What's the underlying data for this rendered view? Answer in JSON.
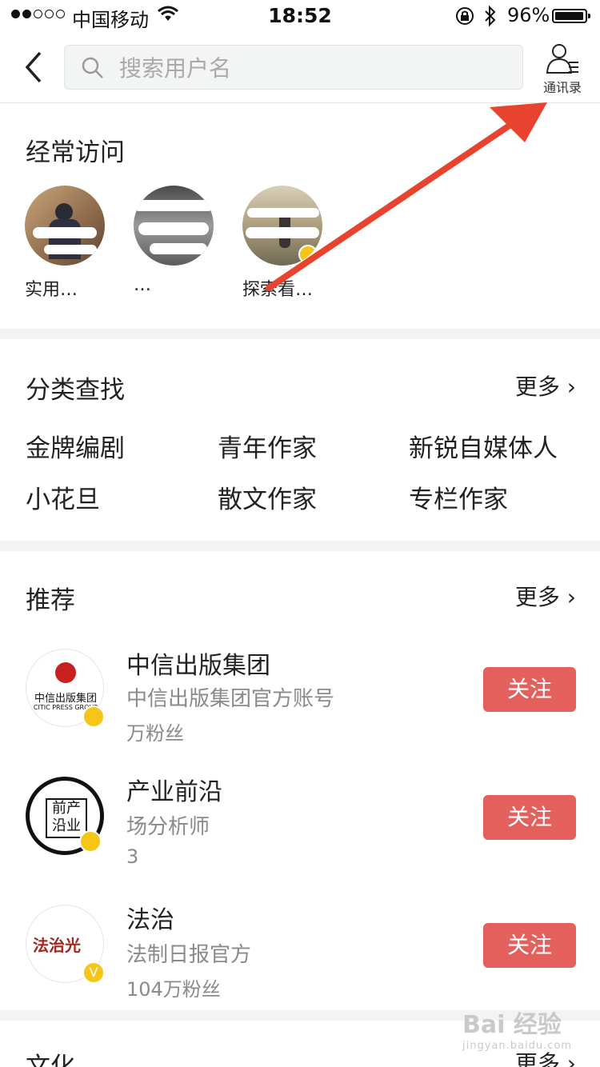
{
  "status_bar": {
    "carrier": "中国移动",
    "time": "18:52",
    "battery": "96%",
    "battery_level": 0.96
  },
  "nav": {
    "search_placeholder": "搜索用户名",
    "contacts_label": "通讯录"
  },
  "frequent": {
    "title": "经常访问",
    "items": [
      {
        "name": "实用…"
      },
      {
        "name": "…"
      },
      {
        "name": "探索看…"
      }
    ]
  },
  "categories": {
    "title": "分类查找",
    "more": "更多",
    "items": [
      "金牌编剧",
      "青年作家",
      "新锐自媒体人",
      "小花旦",
      "散文作家",
      "专栏作家"
    ]
  },
  "recommend": {
    "title": "推荐",
    "more": "更多",
    "follow_label": "关注",
    "items": [
      {
        "name": "中信出版集团",
        "desc": "中信出版集团官方账号",
        "fans": "万粉丝",
        "logo_text": "中信出版集团",
        "logo_sub": "CITIC PRESS GROUP"
      },
      {
        "name": "产业前沿",
        "desc": "场分析师",
        "fans": "3",
        "logo_text": "前产沿业"
      },
      {
        "name": "法治",
        "desc": "法制日报官方",
        "fans": "104万粉丝",
        "logo_text": "法治光"
      }
    ]
  },
  "culture": {
    "title": "文化",
    "more": "更多"
  },
  "watermark": {
    "logo": "Bai 经验",
    "url": "jingyan.baidu.com"
  },
  "colors": {
    "follow_button": "#e4605d",
    "annotation_arrow": "#e8432e",
    "verify_badge": "#f5c518",
    "section_gap": "#f2f3f3"
  }
}
